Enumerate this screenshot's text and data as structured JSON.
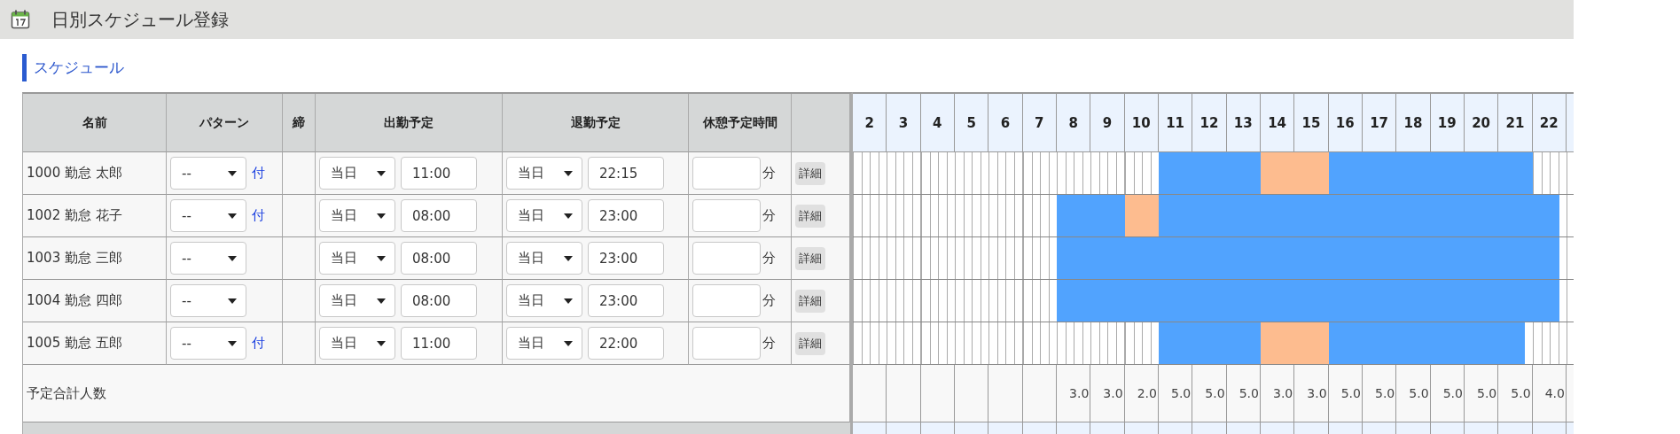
{
  "page": {
    "title": "日別スケジュール登録"
  },
  "section": {
    "title": "スケジュール"
  },
  "table": {
    "columns": [
      "名前",
      "パターン",
      "締",
      "出勤予定",
      "退勤予定",
      "休憩予定時間"
    ],
    "rows": [
      {
        "name": "1000 勤怠 太郎",
        "pattern": "--",
        "attach_link": "付",
        "start_day": "当日",
        "start_time": "11:00",
        "end_day": "当日",
        "end_time": "22:15",
        "break_unit": "分",
        "detail_button": "詳細",
        "slots": [
          {
            "kind": "off"
          },
          {
            "kind": "off"
          },
          {
            "kind": "off"
          },
          {
            "kind": "off"
          },
          {
            "kind": "off"
          },
          {
            "kind": "off"
          },
          {
            "kind": "off"
          },
          {
            "kind": "off"
          },
          {
            "kind": "off"
          },
          {
            "kind": "work"
          },
          {
            "kind": "work"
          },
          {
            "kind": "work"
          },
          {
            "kind": "break"
          },
          {
            "kind": "break"
          },
          {
            "kind": "work"
          },
          {
            "kind": "work"
          },
          {
            "kind": "work"
          },
          {
            "kind": "work"
          },
          {
            "kind": "work"
          },
          {
            "kind": "work"
          },
          {
            "kind": "off"
          }
        ]
      },
      {
        "name": "1002 勤怠 花子",
        "pattern": "--",
        "attach_link": "付",
        "start_day": "当日",
        "start_time": "08:00",
        "end_day": "当日",
        "end_time": "23:00",
        "break_unit": "分",
        "detail_button": "詳細",
        "slots": [
          {
            "kind": "off"
          },
          {
            "kind": "off"
          },
          {
            "kind": "off"
          },
          {
            "kind": "off"
          },
          {
            "kind": "off"
          },
          {
            "kind": "off"
          },
          {
            "kind": "work"
          },
          {
            "kind": "work"
          },
          {
            "kind": "break"
          },
          {
            "kind": "work"
          },
          {
            "kind": "work"
          },
          {
            "kind": "work"
          },
          {
            "kind": "work"
          },
          {
            "kind": "work"
          },
          {
            "kind": "work"
          },
          {
            "kind": "work"
          },
          {
            "kind": "work"
          },
          {
            "kind": "work"
          },
          {
            "kind": "work"
          },
          {
            "kind": "work"
          },
          {
            "kind": "work_end"
          }
        ]
      },
      {
        "name": "1003 勤怠 三郎",
        "pattern": "--",
        "start_day": "当日",
        "start_time": "08:00",
        "end_day": "当日",
        "end_time": "23:00",
        "break_unit": "分",
        "detail_button": "詳細",
        "slots": [
          {
            "kind": "off"
          },
          {
            "kind": "off"
          },
          {
            "kind": "off"
          },
          {
            "kind": "off"
          },
          {
            "kind": "off"
          },
          {
            "kind": "off"
          },
          {
            "kind": "work"
          },
          {
            "kind": "work"
          },
          {
            "kind": "work"
          },
          {
            "kind": "work"
          },
          {
            "kind": "work"
          },
          {
            "kind": "work"
          },
          {
            "kind": "work"
          },
          {
            "kind": "work"
          },
          {
            "kind": "work"
          },
          {
            "kind": "work"
          },
          {
            "kind": "work"
          },
          {
            "kind": "work"
          },
          {
            "kind": "work"
          },
          {
            "kind": "work"
          },
          {
            "kind": "work_end"
          }
        ]
      },
      {
        "name": "1004 勤怠 四郎",
        "pattern": "--",
        "start_day": "当日",
        "start_time": "08:00",
        "end_day": "当日",
        "end_time": "23:00",
        "break_unit": "分",
        "detail_button": "詳細",
        "slots": [
          {
            "kind": "off"
          },
          {
            "kind": "off"
          },
          {
            "kind": "off"
          },
          {
            "kind": "off"
          },
          {
            "kind": "off"
          },
          {
            "kind": "off"
          },
          {
            "kind": "work"
          },
          {
            "kind": "work"
          },
          {
            "kind": "work"
          },
          {
            "kind": "work"
          },
          {
            "kind": "work"
          },
          {
            "kind": "work"
          },
          {
            "kind": "work"
          },
          {
            "kind": "work"
          },
          {
            "kind": "work"
          },
          {
            "kind": "work"
          },
          {
            "kind": "work"
          },
          {
            "kind": "work"
          },
          {
            "kind": "work"
          },
          {
            "kind": "work"
          },
          {
            "kind": "work_end"
          }
        ]
      },
      {
        "name": "1005 勤怠 五郎",
        "pattern": "--",
        "attach_link": "付",
        "start_day": "当日",
        "start_time": "11:00",
        "end_day": "当日",
        "end_time": "22:00",
        "break_unit": "分",
        "detail_button": "詳細",
        "slots": [
          {
            "kind": "off"
          },
          {
            "kind": "off"
          },
          {
            "kind": "off"
          },
          {
            "kind": "off"
          },
          {
            "kind": "off"
          },
          {
            "kind": "off"
          },
          {
            "kind": "off"
          },
          {
            "kind": "off"
          },
          {
            "kind": "off"
          },
          {
            "kind": "work"
          },
          {
            "kind": "work"
          },
          {
            "kind": "work"
          },
          {
            "kind": "break"
          },
          {
            "kind": "break"
          },
          {
            "kind": "work"
          },
          {
            "kind": "work"
          },
          {
            "kind": "work"
          },
          {
            "kind": "work"
          },
          {
            "kind": "work"
          },
          {
            "kind": "work_end"
          },
          {
            "kind": "off"
          }
        ]
      }
    ],
    "total_label": "予定合計人数"
  },
  "timeline": {
    "hours": [
      {
        "label": "2"
      },
      {
        "label": "3"
      },
      {
        "label": "4"
      },
      {
        "label": "5"
      },
      {
        "label": "6"
      },
      {
        "label": "7"
      },
      {
        "label": "8",
        "total": "3.0"
      },
      {
        "label": "9",
        "total": "3.0"
      },
      {
        "label": "10",
        "total": "2.0"
      },
      {
        "label": "11",
        "total": "5.0"
      },
      {
        "label": "12",
        "total": "5.0"
      },
      {
        "label": "13",
        "total": "5.0"
      },
      {
        "label": "14",
        "total": "3.0"
      },
      {
        "label": "15",
        "total": "3.0"
      },
      {
        "label": "16",
        "total": "5.0"
      },
      {
        "label": "17",
        "total": "5.0"
      },
      {
        "label": "18",
        "total": "5.0"
      },
      {
        "label": "19",
        "total": "5.0"
      },
      {
        "label": "20",
        "total": "5.0"
      },
      {
        "label": "21",
        "total": "5.0"
      },
      {
        "label": "22",
        "total": "4.0"
      }
    ]
  }
}
